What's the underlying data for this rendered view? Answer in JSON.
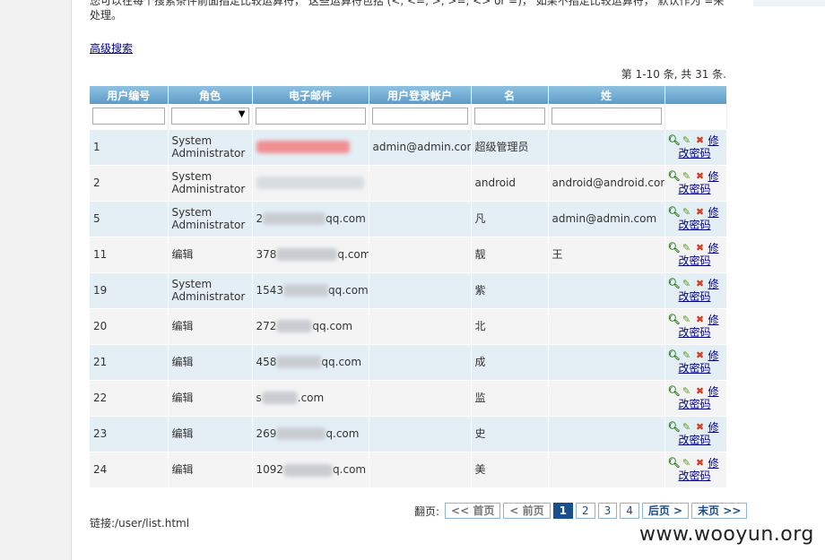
{
  "intro_text": "您可以在每个搜索条件前面指定比较运算符， 这些运算符包括 (<, <=, >, >=, <> or =)， 如果不指定比较运算符， 默认作为 =来处理。",
  "advanced_search_link": "高级搜索",
  "summary": "第 1-10 条, 共 31 条.",
  "columns": [
    "用户编号",
    "角色",
    "电子邮件",
    "用户登录帐户",
    "名",
    "姓"
  ],
  "role_filter_arrow": "▼",
  "rows": [
    {
      "id": "1",
      "role": "System Administrator",
      "email_visible": "",
      "login": "admin@admin.com",
      "first": "超级管理员",
      "last": ""
    },
    {
      "id": "2",
      "role": "System Administrator",
      "email_visible": "",
      "login": "",
      "first": "android",
      "last": "android@android.com"
    },
    {
      "id": "5",
      "role": "System Administrator",
      "email_visible": "2 qq.com",
      "login": "",
      "first": "凡",
      "last": "admin@admin.com"
    },
    {
      "id": "11",
      "role": "编辑",
      "email_visible": "378 q.com",
      "login": "",
      "first": "靓",
      "last": "王"
    },
    {
      "id": "19",
      "role": "System Administrator",
      "email_visible": "1543 qq.com",
      "login": "",
      "first": "紫",
      "last": ""
    },
    {
      "id": "20",
      "role": "编辑",
      "email_visible": "272 qq.com",
      "login": "",
      "first": "北",
      "last": ""
    },
    {
      "id": "21",
      "role": "编辑",
      "email_visible": "458 qq.com",
      "login": "",
      "first": "成",
      "last": ""
    },
    {
      "id": "22",
      "role": "编辑",
      "email_visible": "s .com",
      "login": "",
      "first": "监",
      "last": ""
    },
    {
      "id": "23",
      "role": "编辑",
      "email_visible": "269 q.com",
      "login": "",
      "first": "史",
      "last": ""
    },
    {
      "id": "24",
      "role": "编辑",
      "email_visible": "1092 q.com",
      "login": "",
      "first": "美",
      "last": ""
    }
  ],
  "row_actions": {
    "view_icon": "view-icon",
    "edit_icon": "pencil-icon",
    "delete_icon": "delete-icon",
    "change_password": "修改密码"
  },
  "pager": {
    "label": "翻页:",
    "first": "<< 首页",
    "prev": "< 前页",
    "pages": [
      "1",
      "2",
      "3",
      "4"
    ],
    "current_page": "1",
    "next": "后页 >",
    "last": "末页 >>"
  },
  "link_line": "链接:/user/list.html",
  "watermark": "www.wooyun.org"
}
